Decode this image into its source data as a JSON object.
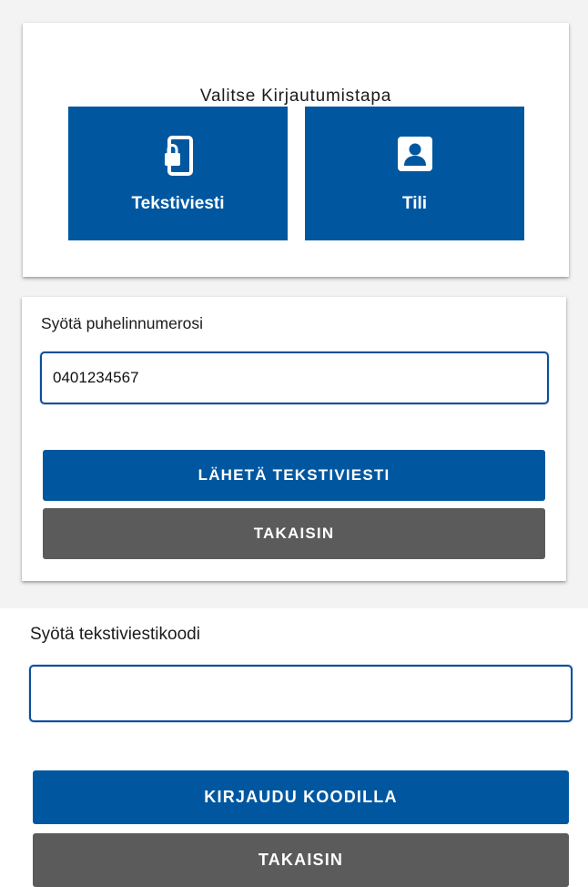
{
  "login_method": {
    "title": "Valitse Kirjautumistapa",
    "options": [
      {
        "label": "Tekstiviesti",
        "icon": "phone-lock-icon"
      },
      {
        "label": "Tili",
        "icon": "account-icon"
      }
    ]
  },
  "phone_step": {
    "label": "Syötä puhelinnumerosi",
    "phone_value": "0401234567",
    "send_button": "LÄHETÄ TEKSTIVIESTI",
    "back_button": "TAKAISIN"
  },
  "code_step": {
    "label": "Syötä tekstiviestikoodi",
    "code_value": "",
    "login_button": "KIRJAUDU KOODILLA",
    "back_button": "TAKAISIN"
  },
  "colors": {
    "primary": "#0057a0",
    "secondary": "#5b5b5b",
    "input_border": "#0b4f99"
  }
}
